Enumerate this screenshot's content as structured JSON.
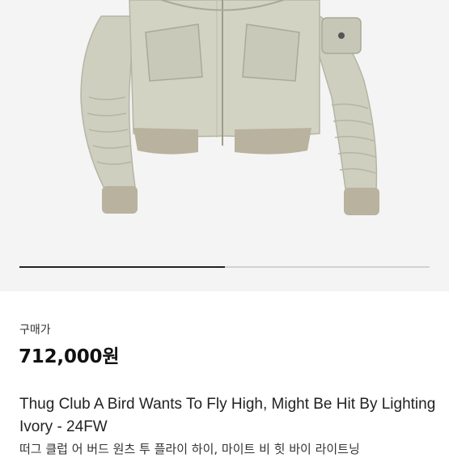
{
  "product": {
    "image_alt": "Ivory bomber jacket",
    "carousel_progress": 0.5,
    "price_label": "구매가",
    "price": "712,000원",
    "title": "Thug Club A Bird Wants To Fly High, Might Be Hit By Lighting Ivory - 24FW",
    "description_preview": "떠그 클럽 어 버드 원츠 투 플라이 하이, 마이트 비 힛 바이 라이트닝"
  },
  "colors": {
    "jacket": "#cfcfc0",
    "jacket_shadow": "#b5b5a4",
    "ribbing": "#b8b29e",
    "background": "#f4f4f4"
  }
}
